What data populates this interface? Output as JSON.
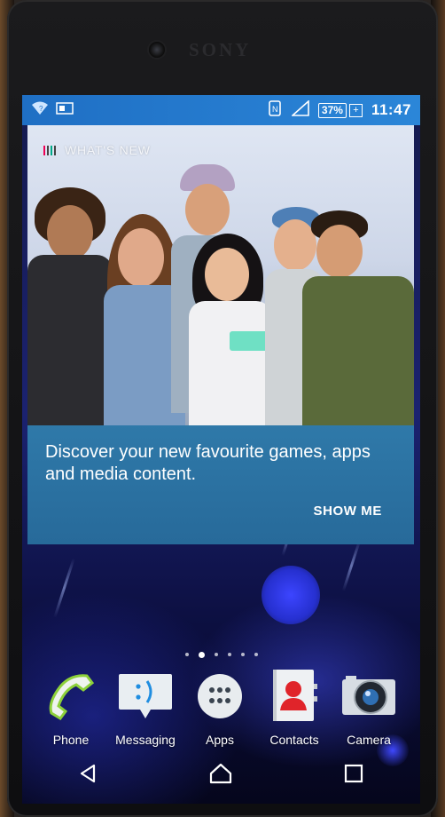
{
  "device": {
    "brand": "SONY"
  },
  "status_bar": {
    "time": "11:47",
    "battery": "37%",
    "icons": [
      "wifi-icon",
      "screenshot-icon",
      "nfc-icon",
      "signal-icon",
      "battery-icon"
    ]
  },
  "card": {
    "header_title": "WHAT'S NEW",
    "description": "Discover your new favourite games, apps and media content.",
    "action_label": "SHOW ME"
  },
  "home": {
    "page_count": 6,
    "active_page": 2
  },
  "dock": {
    "apps": [
      {
        "label": "Phone",
        "icon": "phone-icon"
      },
      {
        "label": "Messaging",
        "icon": "messaging-icon"
      },
      {
        "label": "Apps",
        "icon": "apps-grid-icon"
      },
      {
        "label": "Contacts",
        "icon": "contacts-icon"
      },
      {
        "label": "Camera",
        "icon": "camera-icon"
      }
    ]
  },
  "navigation": [
    "back-icon",
    "home-icon",
    "recents-icon"
  ],
  "colors": {
    "status_bar": "#2b86d8",
    "card_body": "#2f79a9",
    "wallpaper": "#1b2270"
  }
}
